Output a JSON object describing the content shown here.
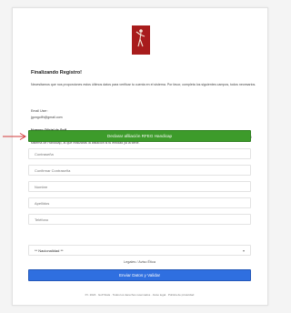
{
  "colors": {
    "brand_red": "#a81c1c",
    "green_button": "#3d9b2b",
    "blue_button": "#2f6fe0",
    "arrow": "#d23a3a"
  },
  "icons": {
    "logo": "golfer-logo-icon",
    "arrow": "arrow-right-icon",
    "select_chevron": "chevron-down-icon"
  },
  "form": {
    "title": "Finalizando Registro!",
    "intro": "Necesitamos que nos proporciones estos últimos datos para verificar tu cuenta en el sistema. Por favor, completa los siguientes campos, todos necesarios.",
    "email_label": "Email User:",
    "email_value": "jgongolfh@gmail.com",
    "member_label": "Numero Oficial de Golf",
    "member_text": "Por favor indícanos si tienes una matrícula oficial de Handicap de golf. Si lo tienes es muy importante que lo indiques ahora para poder reconocer con el sistema de Handicap, al que realizarás la afiliación si tu entidad ya la tiene.",
    "green_button_label": "Declarar afiliación RFEG Handicap",
    "fields": [
      {
        "placeholder": "Contraseña"
      },
      {
        "placeholder": "Confirmar Contraseña"
      },
      {
        "placeholder": "Nombre"
      },
      {
        "placeholder": "Apellidos"
      },
      {
        "placeholder": "Teléfono"
      }
    ],
    "nationality_value": "** Nacionalidad **",
    "legal_text": "Legales / Aviso Ética",
    "submit_label": "Enviar Datos y Validar",
    "footer": "P.I. 2024 · Golf Stats · Todos los derechos reservados · Aviso legal · Política de privacidad"
  }
}
